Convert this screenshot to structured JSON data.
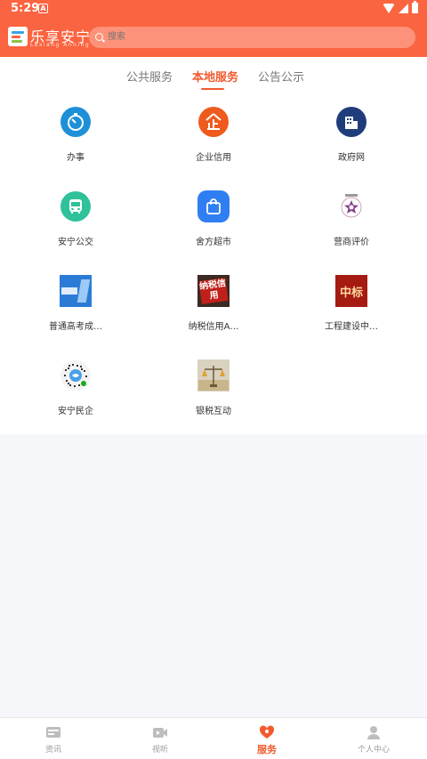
{
  "status": {
    "time": "5:29",
    "notification_letter": "A"
  },
  "app": {
    "title": "乐享安宁",
    "subtitle": "Lexiang Anning"
  },
  "search": {
    "placeholder": "搜索"
  },
  "tabs": [
    {
      "label": "公共服务",
      "active": false
    },
    {
      "label": "本地服务",
      "active": true
    },
    {
      "label": "公告公示",
      "active": false
    }
  ],
  "services": [
    {
      "label": "办事",
      "icon": "timer-icon"
    },
    {
      "label": "企业信用",
      "icon": "enterprise-icon"
    },
    {
      "label": "政府网",
      "icon": "building-icon"
    },
    {
      "label": "安宁公交",
      "icon": "bus-icon"
    },
    {
      "label": "舍方超市",
      "icon": "shopping-bag-icon"
    },
    {
      "label": "营商评价",
      "icon": "emblem-icon"
    },
    {
      "label": "普通高考成…",
      "icon": "exam-icon"
    },
    {
      "label": "纳税信用A…",
      "icon": "tax-credit-icon",
      "icon_text": "纳税信用"
    },
    {
      "label": "工程建设中…",
      "icon": "bid-icon",
      "icon_text": "中标"
    },
    {
      "label": "安宁民企",
      "icon": "qr-code-icon"
    },
    {
      "label": "银税互动",
      "icon": "scale-icon"
    }
  ],
  "tabbar": [
    {
      "label": "资讯",
      "icon": "news-icon",
      "active": false
    },
    {
      "label": "视听",
      "icon": "video-icon",
      "active": false
    },
    {
      "label": "服务",
      "icon": "service-icon",
      "active": true
    },
    {
      "label": "个人中心",
      "icon": "person-icon",
      "active": false
    }
  ],
  "colors": {
    "header": "#fb6440",
    "accent": "#f25a2e",
    "background": "#f5f7fa"
  }
}
